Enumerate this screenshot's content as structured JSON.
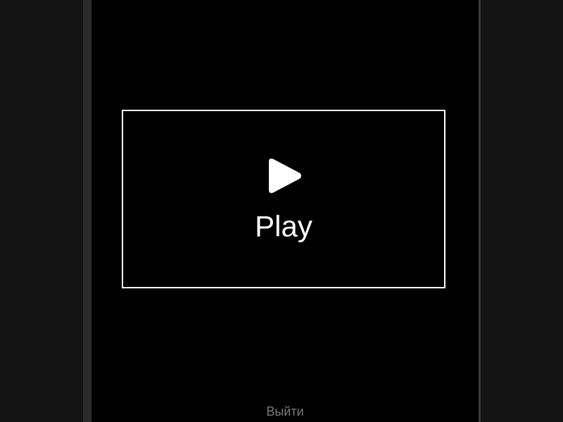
{
  "screen": {
    "background_color": "#000000",
    "play_button": {
      "label": "Play",
      "icon": "play-icon",
      "border_color": "#ffffff"
    },
    "exit_link": {
      "label": "Выйти",
      "color": "#7a7a7a"
    }
  }
}
